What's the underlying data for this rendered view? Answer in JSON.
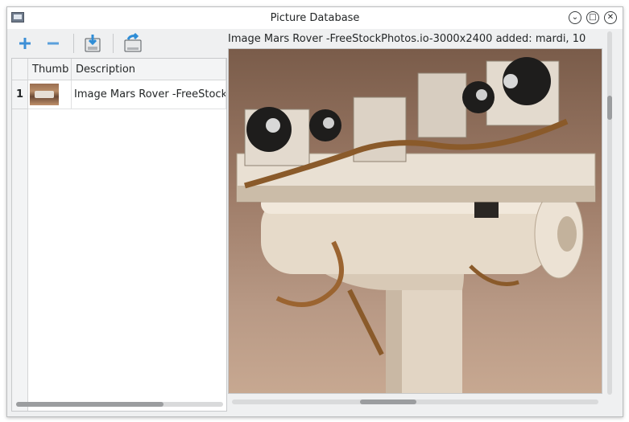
{
  "window": {
    "title": "Picture Database",
    "controls": {
      "minimize": "⌄",
      "maximize": "□",
      "close": "✕"
    }
  },
  "toolbar": {
    "buttons": [
      {
        "name": "add-button",
        "icon": "plus-icon"
      },
      {
        "name": "remove-button",
        "icon": "minus-icon"
      },
      {
        "name": "import-button",
        "icon": "import-icon"
      },
      {
        "name": "export-button",
        "icon": "export-icon"
      }
    ]
  },
  "table": {
    "headers": {
      "thumb": "Thumb",
      "description": "Description"
    },
    "rows": [
      {
        "number": "1",
        "description": "Image Mars Rover -FreeStockP"
      }
    ]
  },
  "viewer": {
    "caption": "Image Mars Rover -FreeStockPhotos.io-3000x2400 added: mardi, 10"
  },
  "colors": {
    "accent": "#3daee9",
    "window_bg": "#eff0f1",
    "pane_bg": "#ffffff"
  }
}
